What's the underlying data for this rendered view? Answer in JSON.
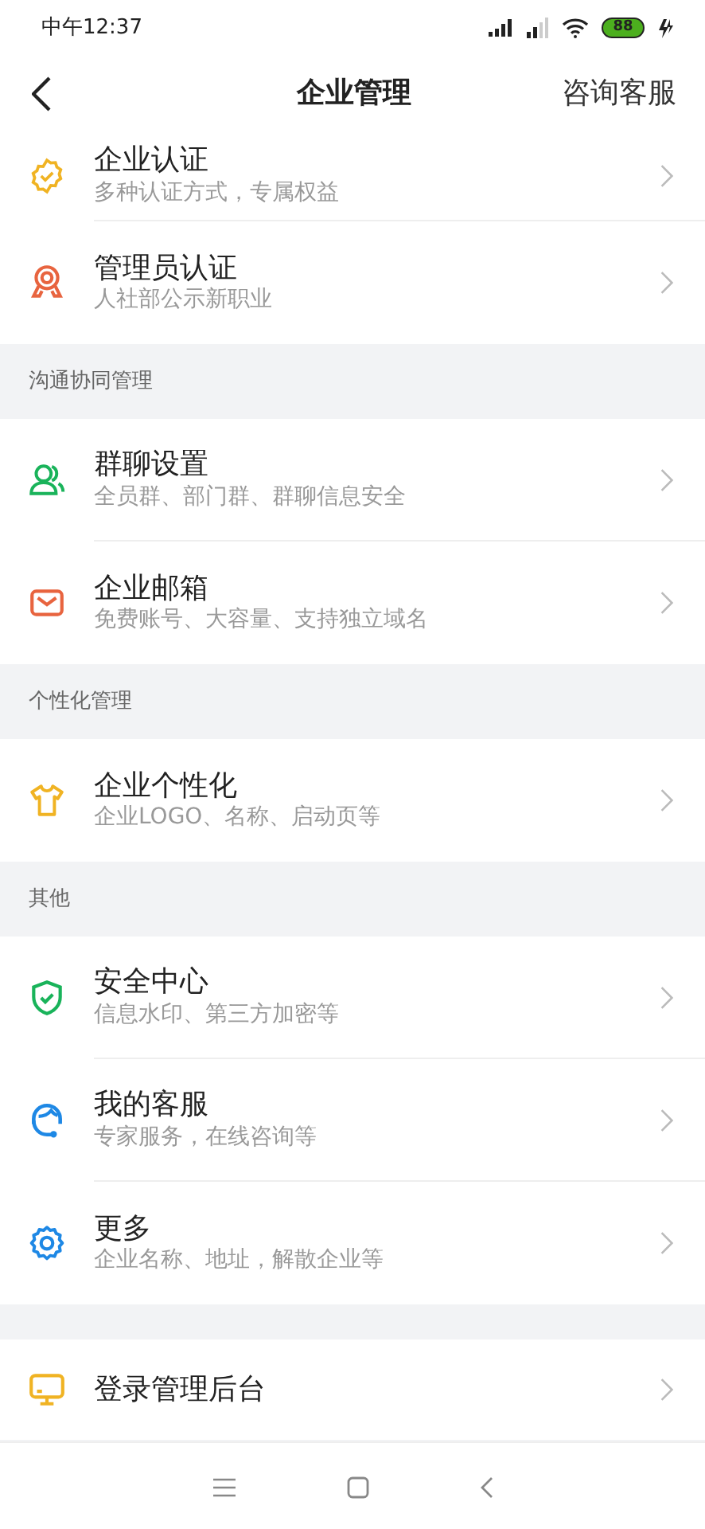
{
  "status_bar": {
    "time": "中午12:37",
    "battery": "88"
  },
  "header": {
    "title": "企业管理",
    "action": "咨询客服"
  },
  "sections": [
    {
      "items": [
        {
          "title": "企业认证",
          "subtitle": "多种认证方式，专属权益"
        },
        {
          "title": "管理员认证",
          "subtitle": "人社部公示新职业"
        }
      ]
    },
    {
      "header": "沟通协同管理",
      "items": [
        {
          "title": "群聊设置",
          "subtitle": "全员群、部门群、群聊信息安全"
        },
        {
          "title": "企业邮箱",
          "subtitle": "免费账号、大容量、支持独立域名"
        }
      ]
    },
    {
      "header": "个性化管理",
      "items": [
        {
          "title": "企业个性化",
          "subtitle": "企业LOGO、名称、启动页等"
        }
      ]
    },
    {
      "header": "其他",
      "items": [
        {
          "title": "安全中心",
          "subtitle": "信息水印、第三方加密等"
        },
        {
          "title": "我的客服",
          "subtitle": "专家服务，在线咨询等"
        },
        {
          "title": "更多",
          "subtitle": "企业名称、地址，解散企业等"
        }
      ]
    },
    {
      "items": [
        {
          "title": "登录管理后台"
        }
      ]
    }
  ]
}
